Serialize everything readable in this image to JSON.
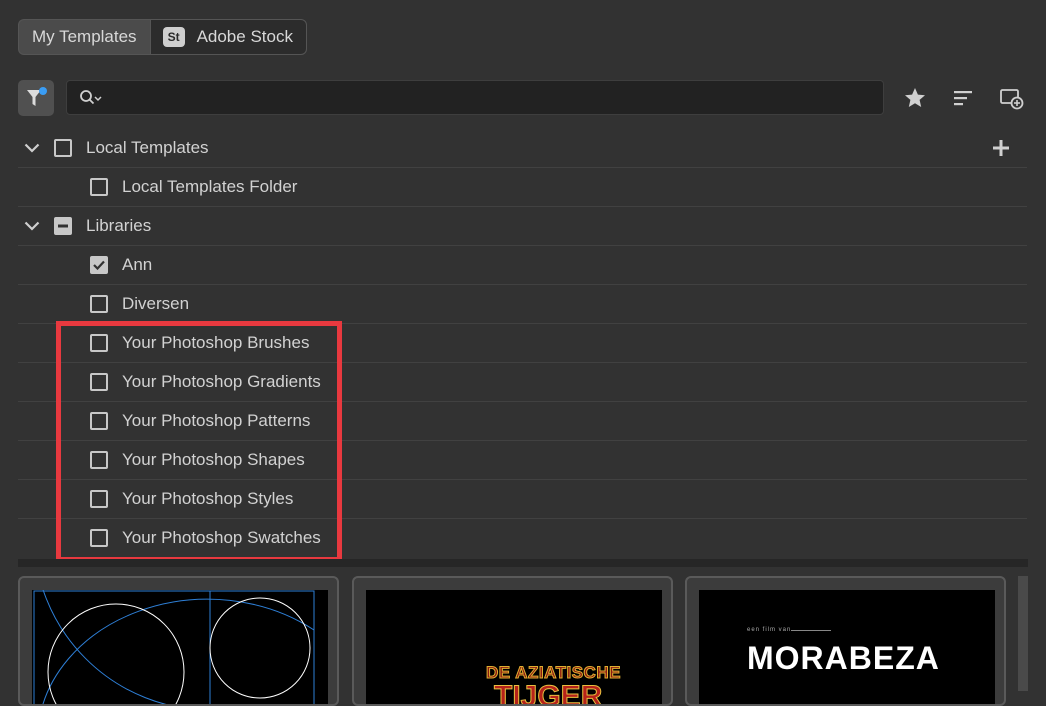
{
  "tabs": {
    "my_templates": "My Templates",
    "stock_badge": "St",
    "adobe_stock": "Adobe Stock"
  },
  "search": {
    "placeholder": "",
    "value": ""
  },
  "toolbar_icons": [
    "filter-icon",
    "search-icon",
    "star-icon",
    "sort-lines-icon",
    "new-window-icon"
  ],
  "tree": {
    "local_templates": {
      "label": "Local Templates",
      "expanded": true,
      "state": "unchecked"
    },
    "local_templates_folder": {
      "label": "Local Templates Folder",
      "state": "unchecked"
    },
    "libraries": {
      "label": "Libraries",
      "expanded": true,
      "state": "mixed"
    },
    "library_items": [
      {
        "label": "Ann",
        "state": "checked"
      },
      {
        "label": "Diversen",
        "state": "unchecked"
      },
      {
        "label": "Your Photoshop Brushes",
        "state": "unchecked"
      },
      {
        "label": "Your Photoshop Gradients",
        "state": "unchecked"
      },
      {
        "label": "Your Photoshop Patterns",
        "state": "unchecked"
      },
      {
        "label": "Your Photoshop Shapes",
        "state": "unchecked"
      },
      {
        "label": "Your Photoshop Styles",
        "state": "unchecked"
      },
      {
        "label": "Your Photoshop Swatches",
        "state": "unchecked"
      }
    ]
  },
  "cards": [
    {
      "caption_small": "",
      "caption": ""
    },
    {
      "caption_small": "DE AZIATISCHE",
      "caption": "TIJGER"
    },
    {
      "caption_small": "een film van",
      "caption": "MORABEZA"
    }
  ],
  "colors": {
    "background": "#323232",
    "highlight": "#e8393f",
    "filter_dot": "#3a9df5",
    "golden_ratio_lines": "#2e7fd6"
  }
}
